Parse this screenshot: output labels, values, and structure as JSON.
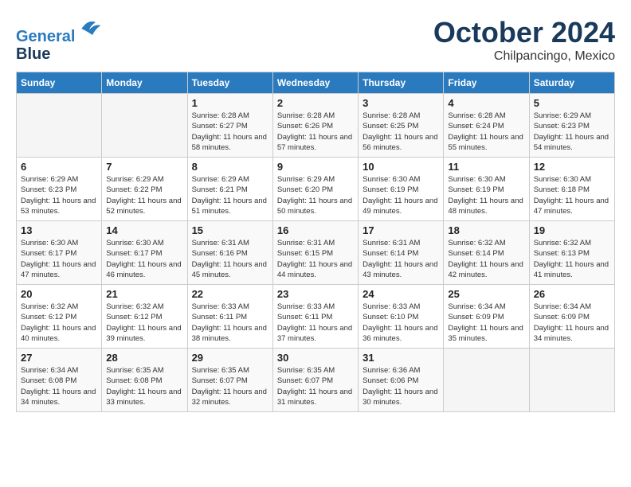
{
  "header": {
    "logo_line1": "General",
    "logo_line2": "Blue",
    "month": "October 2024",
    "location": "Chilpancingo, Mexico"
  },
  "weekdays": [
    "Sunday",
    "Monday",
    "Tuesday",
    "Wednesday",
    "Thursday",
    "Friday",
    "Saturday"
  ],
  "weeks": [
    [
      {
        "day": "",
        "info": ""
      },
      {
        "day": "",
        "info": ""
      },
      {
        "day": "1",
        "info": "Sunrise: 6:28 AM\nSunset: 6:27 PM\nDaylight: 11 hours and 58 minutes."
      },
      {
        "day": "2",
        "info": "Sunrise: 6:28 AM\nSunset: 6:26 PM\nDaylight: 11 hours and 57 minutes."
      },
      {
        "day": "3",
        "info": "Sunrise: 6:28 AM\nSunset: 6:25 PM\nDaylight: 11 hours and 56 minutes."
      },
      {
        "day": "4",
        "info": "Sunrise: 6:28 AM\nSunset: 6:24 PM\nDaylight: 11 hours and 55 minutes."
      },
      {
        "day": "5",
        "info": "Sunrise: 6:29 AM\nSunset: 6:23 PM\nDaylight: 11 hours and 54 minutes."
      }
    ],
    [
      {
        "day": "6",
        "info": "Sunrise: 6:29 AM\nSunset: 6:23 PM\nDaylight: 11 hours and 53 minutes."
      },
      {
        "day": "7",
        "info": "Sunrise: 6:29 AM\nSunset: 6:22 PM\nDaylight: 11 hours and 52 minutes."
      },
      {
        "day": "8",
        "info": "Sunrise: 6:29 AM\nSunset: 6:21 PM\nDaylight: 11 hours and 51 minutes."
      },
      {
        "day": "9",
        "info": "Sunrise: 6:29 AM\nSunset: 6:20 PM\nDaylight: 11 hours and 50 minutes."
      },
      {
        "day": "10",
        "info": "Sunrise: 6:30 AM\nSunset: 6:19 PM\nDaylight: 11 hours and 49 minutes."
      },
      {
        "day": "11",
        "info": "Sunrise: 6:30 AM\nSunset: 6:19 PM\nDaylight: 11 hours and 48 minutes."
      },
      {
        "day": "12",
        "info": "Sunrise: 6:30 AM\nSunset: 6:18 PM\nDaylight: 11 hours and 47 minutes."
      }
    ],
    [
      {
        "day": "13",
        "info": "Sunrise: 6:30 AM\nSunset: 6:17 PM\nDaylight: 11 hours and 47 minutes."
      },
      {
        "day": "14",
        "info": "Sunrise: 6:30 AM\nSunset: 6:17 PM\nDaylight: 11 hours and 46 minutes."
      },
      {
        "day": "15",
        "info": "Sunrise: 6:31 AM\nSunset: 6:16 PM\nDaylight: 11 hours and 45 minutes."
      },
      {
        "day": "16",
        "info": "Sunrise: 6:31 AM\nSunset: 6:15 PM\nDaylight: 11 hours and 44 minutes."
      },
      {
        "day": "17",
        "info": "Sunrise: 6:31 AM\nSunset: 6:14 PM\nDaylight: 11 hours and 43 minutes."
      },
      {
        "day": "18",
        "info": "Sunrise: 6:32 AM\nSunset: 6:14 PM\nDaylight: 11 hours and 42 minutes."
      },
      {
        "day": "19",
        "info": "Sunrise: 6:32 AM\nSunset: 6:13 PM\nDaylight: 11 hours and 41 minutes."
      }
    ],
    [
      {
        "day": "20",
        "info": "Sunrise: 6:32 AM\nSunset: 6:12 PM\nDaylight: 11 hours and 40 minutes."
      },
      {
        "day": "21",
        "info": "Sunrise: 6:32 AM\nSunset: 6:12 PM\nDaylight: 11 hours and 39 minutes."
      },
      {
        "day": "22",
        "info": "Sunrise: 6:33 AM\nSunset: 6:11 PM\nDaylight: 11 hours and 38 minutes."
      },
      {
        "day": "23",
        "info": "Sunrise: 6:33 AM\nSunset: 6:11 PM\nDaylight: 11 hours and 37 minutes."
      },
      {
        "day": "24",
        "info": "Sunrise: 6:33 AM\nSunset: 6:10 PM\nDaylight: 11 hours and 36 minutes."
      },
      {
        "day": "25",
        "info": "Sunrise: 6:34 AM\nSunset: 6:09 PM\nDaylight: 11 hours and 35 minutes."
      },
      {
        "day": "26",
        "info": "Sunrise: 6:34 AM\nSunset: 6:09 PM\nDaylight: 11 hours and 34 minutes."
      }
    ],
    [
      {
        "day": "27",
        "info": "Sunrise: 6:34 AM\nSunset: 6:08 PM\nDaylight: 11 hours and 34 minutes."
      },
      {
        "day": "28",
        "info": "Sunrise: 6:35 AM\nSunset: 6:08 PM\nDaylight: 11 hours and 33 minutes."
      },
      {
        "day": "29",
        "info": "Sunrise: 6:35 AM\nSunset: 6:07 PM\nDaylight: 11 hours and 32 minutes."
      },
      {
        "day": "30",
        "info": "Sunrise: 6:35 AM\nSunset: 6:07 PM\nDaylight: 11 hours and 31 minutes."
      },
      {
        "day": "31",
        "info": "Sunrise: 6:36 AM\nSunset: 6:06 PM\nDaylight: 11 hours and 30 minutes."
      },
      {
        "day": "",
        "info": ""
      },
      {
        "day": "",
        "info": ""
      }
    ]
  ]
}
